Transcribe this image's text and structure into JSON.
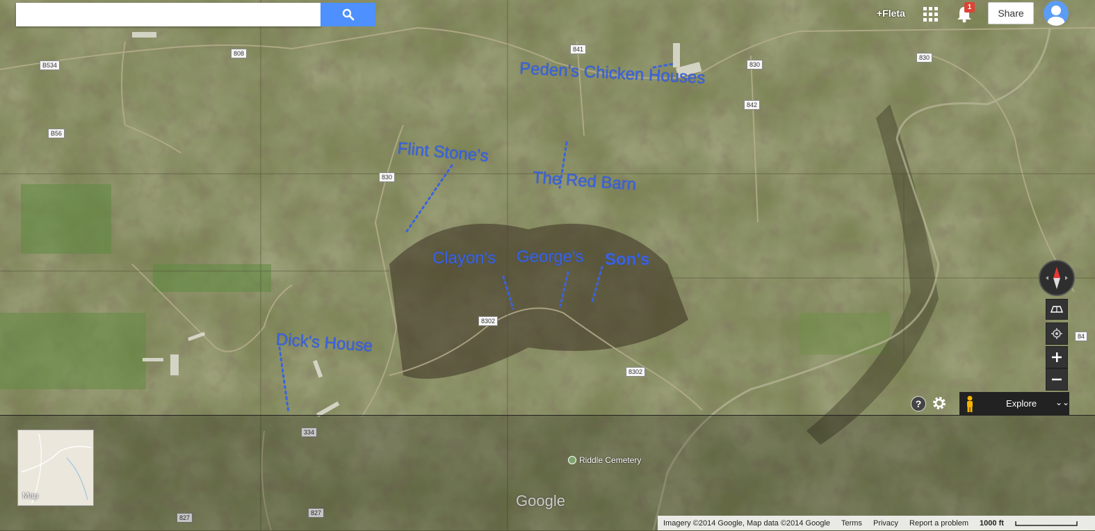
{
  "search": {
    "value": "",
    "placeholder": "",
    "button_icon": "search-icon"
  },
  "header": {
    "user_label": "+Fleta",
    "notification_count": "1",
    "share_label": "Share",
    "apps_icon": "apps-grid-icon",
    "bell_icon": "bell-icon"
  },
  "annotations": [
    {
      "label": "Peden's Chicken Houses"
    },
    {
      "label": "Flint Stone's"
    },
    {
      "label": "The Red Barn"
    },
    {
      "label": "Clayon's"
    },
    {
      "label": "George's"
    },
    {
      "label": "Son's"
    },
    {
      "label": "Dick's House"
    }
  ],
  "road_shields": [
    "808",
    "841",
    "830",
    "830",
    "842",
    "B534",
    "B56",
    "830",
    "8302",
    "8302",
    "334",
    "827",
    "827",
    "84"
  ],
  "place_label": "Riddle Cemetery",
  "minimap": {
    "label": "Map"
  },
  "explore": {
    "label": "Explore"
  },
  "logo": "Google",
  "footer": {
    "attribution": "Imagery ©2014 Google, Map data ©2014 Google",
    "terms": "Terms",
    "privacy": "Privacy",
    "report": "Report a problem",
    "scale": "1000 ft"
  },
  "colors": {
    "annotation": "#3a63e0",
    "search_button": "#4d90fe",
    "badge": "#db4437"
  }
}
